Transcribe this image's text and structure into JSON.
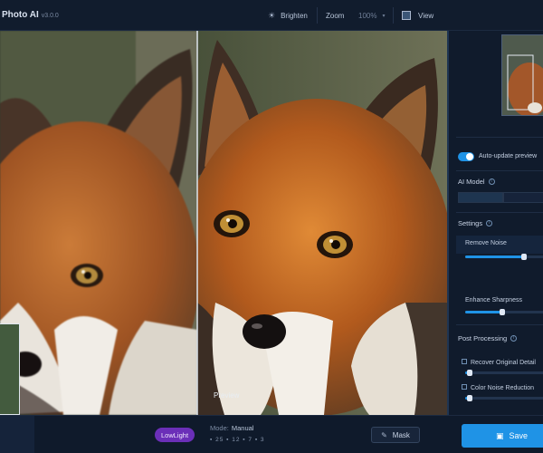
{
  "app": {
    "title": "Photo AI",
    "version": "v3.0.0"
  },
  "toolbar": {
    "brighten_label": "Brighten",
    "zoom_label": "Zoom",
    "zoom_value": "100%",
    "view_label": "View"
  },
  "preview": {
    "label": "Preview"
  },
  "bottom": {
    "lowlight_label": "LowLight",
    "mode_prefix": "Mode:",
    "mode_value": "Manual",
    "mode_values": "▪ 25 ▪ 12 ▪ 7 ▪ 3",
    "mask_label": "Mask",
    "save_label": "Save"
  },
  "panel": {
    "autoupdate_label": "Auto-update preview",
    "autoupdate_on": true,
    "ai_model_label": "AI Model",
    "settings_label": "Settings",
    "remove_noise_label": "Remove Noise",
    "remove_noise_value": 0.72,
    "enhance_sharpness_label": "Enhance Sharpness",
    "enhance_sharpness_value": 0.45,
    "post_processing_label": "Post Processing",
    "recover_detail_label": "Recover Original Detail",
    "recover_detail_value": 0.05,
    "color_noise_label": "Color Noise Reduction",
    "color_noise_value": 0.05
  },
  "colors": {
    "accent": "#1f93e6",
    "lowlight_badge": "#6b2fb8",
    "background": "#0d1726"
  }
}
